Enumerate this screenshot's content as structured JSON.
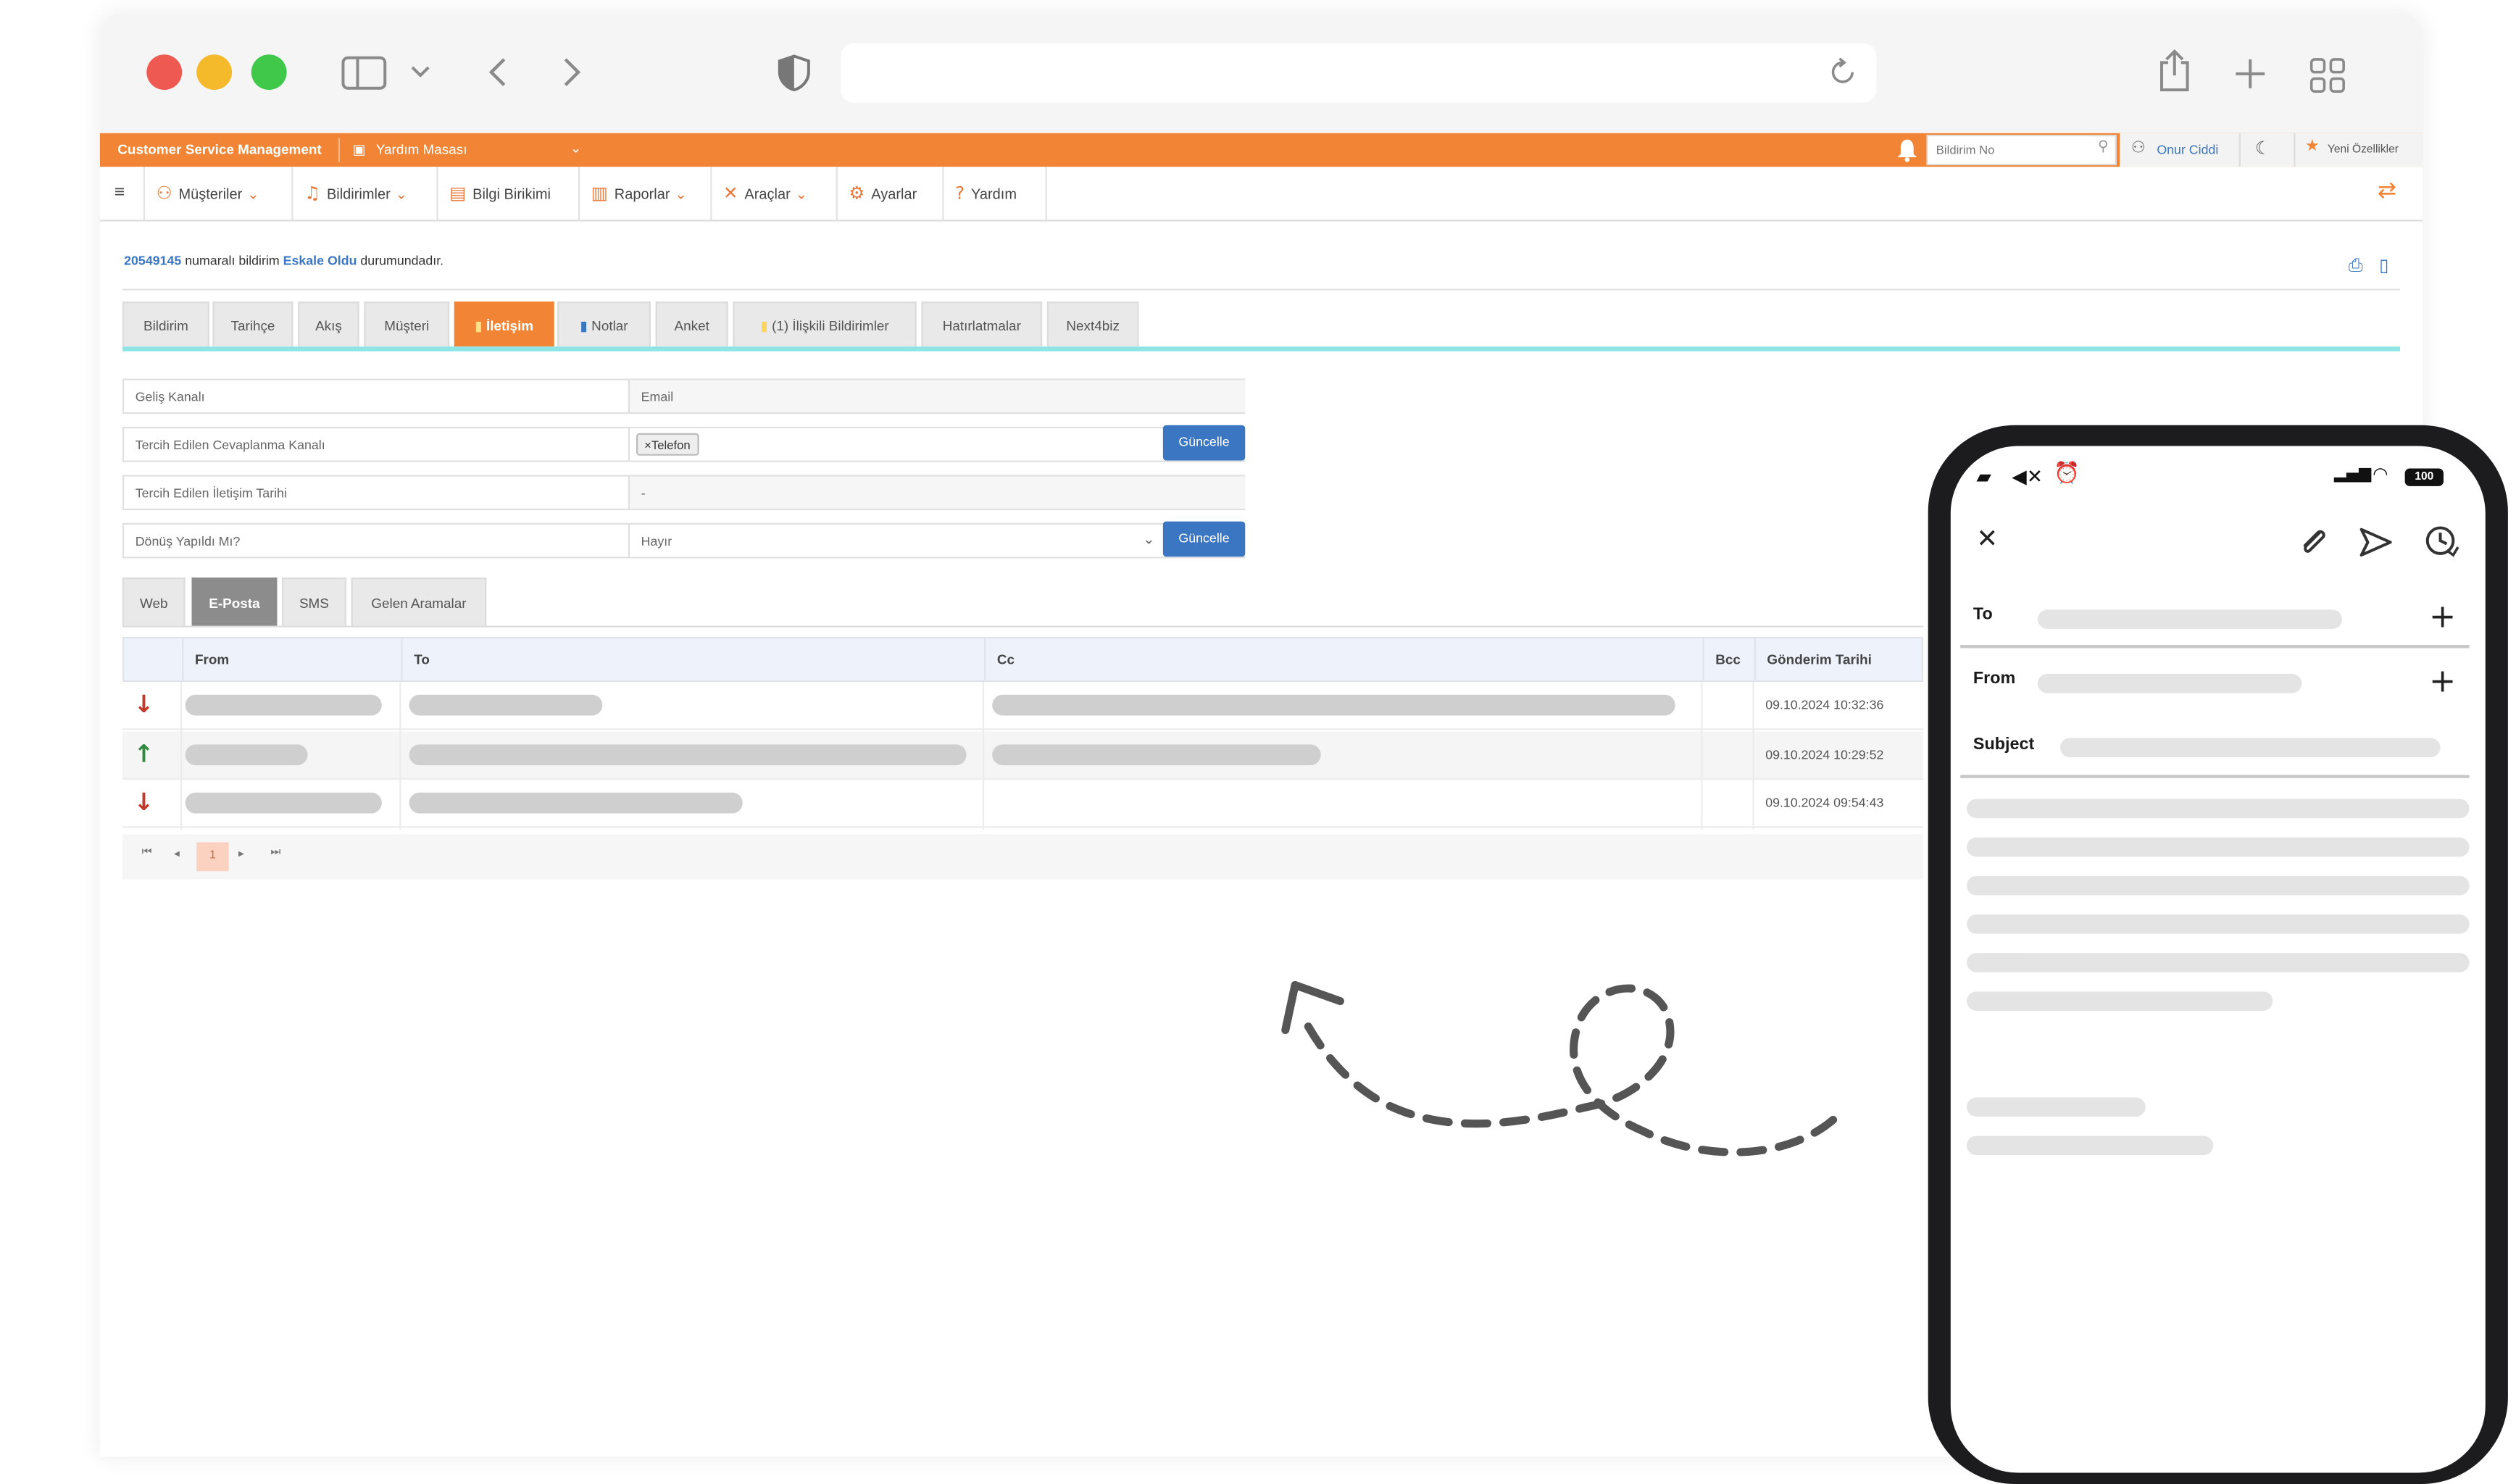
{
  "app": {
    "brand": "Customer Service Management",
    "module": "Yardım Masası",
    "search_placeholder": "Bildirim No",
    "user": "Onur Ciddi",
    "new_features": "Yeni Özellikler"
  },
  "nav": {
    "items": [
      {
        "label": "Müşteriler",
        "icon": "users-icon",
        "dropdown": true
      },
      {
        "label": "Bildirimler",
        "icon": "bell-icon",
        "dropdown": true
      },
      {
        "label": "Bilgi Birikimi",
        "icon": "book-icon",
        "dropdown": false
      },
      {
        "label": "Raporlar",
        "icon": "chart-icon",
        "dropdown": true
      },
      {
        "label": "Araçlar",
        "icon": "tools-icon",
        "dropdown": true
      },
      {
        "label": "Ayarlar",
        "icon": "gear-icon",
        "dropdown": false
      },
      {
        "label": "Yardım",
        "icon": "help-icon",
        "dropdown": false
      }
    ]
  },
  "status": {
    "ticket_no": "20549145",
    "text1": "numaralı bildirim",
    "state": "Eskale Oldu",
    "text2": "durumundadır."
  },
  "tabs": [
    "Bildirim",
    "Tarihçe",
    "Akış",
    "Müşteri",
    "İletişim",
    "Notlar",
    "Anket",
    "(1) İlişkili Bildirimler",
    "Hatırlatmalar",
    "Next4biz"
  ],
  "active_tab": "İletişim",
  "form": {
    "channel_label": "Geliş Kanalı",
    "channel_value": "Email",
    "pref_channel_label": "Tercih Edilen Cevaplanma Kanalı",
    "pref_channel_tag": "Telefon",
    "pref_date_label": "Tercih Edilen İletişim Tarihi",
    "pref_date_value": "-",
    "returned_label": "Dönüş Yapıldı Mı?",
    "returned_value": "Hayır",
    "update_label": "Güncelle"
  },
  "subtabs": [
    "Web",
    "E-Posta",
    "SMS",
    "Gelen Aramalar"
  ],
  "active_subtab": "E-Posta",
  "grid": {
    "columns": [
      "From",
      "To",
      "Cc",
      "Bcc",
      "Gönderim Tarihi"
    ],
    "rows": [
      {
        "direction": "incoming",
        "date": "09.10.2024 10:32:36"
      },
      {
        "direction": "outgoing",
        "date": "09.10.2024 10:29:52"
      },
      {
        "direction": "incoming",
        "date": "09.10.2024 09:54:43"
      }
    ],
    "page": "1"
  },
  "compose": {
    "battery": "100",
    "to_label": "To",
    "from_label": "From",
    "subject_label": "Subject"
  },
  "colors": {
    "accent_orange": "#f28535",
    "button_blue": "#3a76c1",
    "incoming_red": "#c0392b",
    "outgoing_green": "#2e8b3e",
    "tab_underline": "#8fe5e5"
  }
}
